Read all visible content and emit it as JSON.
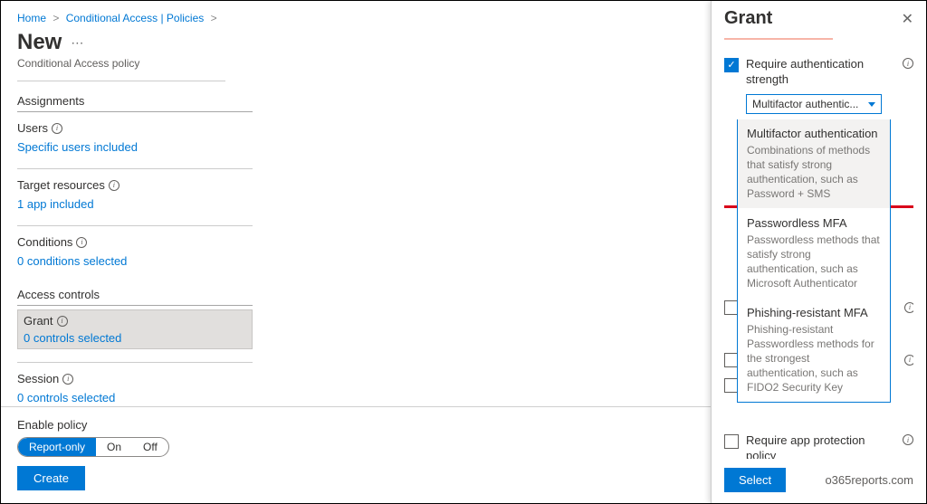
{
  "breadcrumb": {
    "home": "Home",
    "ca": "Conditional Access",
    "policies": "Policies"
  },
  "page": {
    "title": "New",
    "subtitle": "Conditional Access policy"
  },
  "assignments": {
    "heading": "Assignments",
    "users": {
      "label": "Users",
      "value": "Specific users included"
    },
    "targets": {
      "label": "Target resources",
      "value": "1 app included"
    },
    "conditions": {
      "label": "Conditions",
      "value": "0 conditions selected"
    }
  },
  "access": {
    "heading": "Access controls",
    "grant": {
      "label": "Grant",
      "value": "0 controls selected"
    },
    "session": {
      "label": "Session",
      "value": "0 controls selected"
    }
  },
  "enable": {
    "label": "Enable policy",
    "report": "Report-only",
    "on": "On",
    "off": "Off"
  },
  "create": "Create",
  "panel": {
    "title": "Grant",
    "reqAuth": "Require authentication strength",
    "ddSelected": "Multifactor authentic...",
    "opts": [
      {
        "title": "Multifactor authentication",
        "desc": "Combinations of methods that satisfy strong authentication, such as Password + SMS"
      },
      {
        "title": "Passwordless MFA",
        "desc": "Passwordless methods that satisfy strong authentication, such as Microsoft Authenticator"
      },
      {
        "title": "Phishing-resistant MFA",
        "desc": "Phishing-resistant Passwordless methods for the strongest authentication, such as FIDO2 Security Key"
      }
    ],
    "reqApp": "Require app protection policy",
    "select": "Select"
  },
  "watermark": "o365reports.com"
}
